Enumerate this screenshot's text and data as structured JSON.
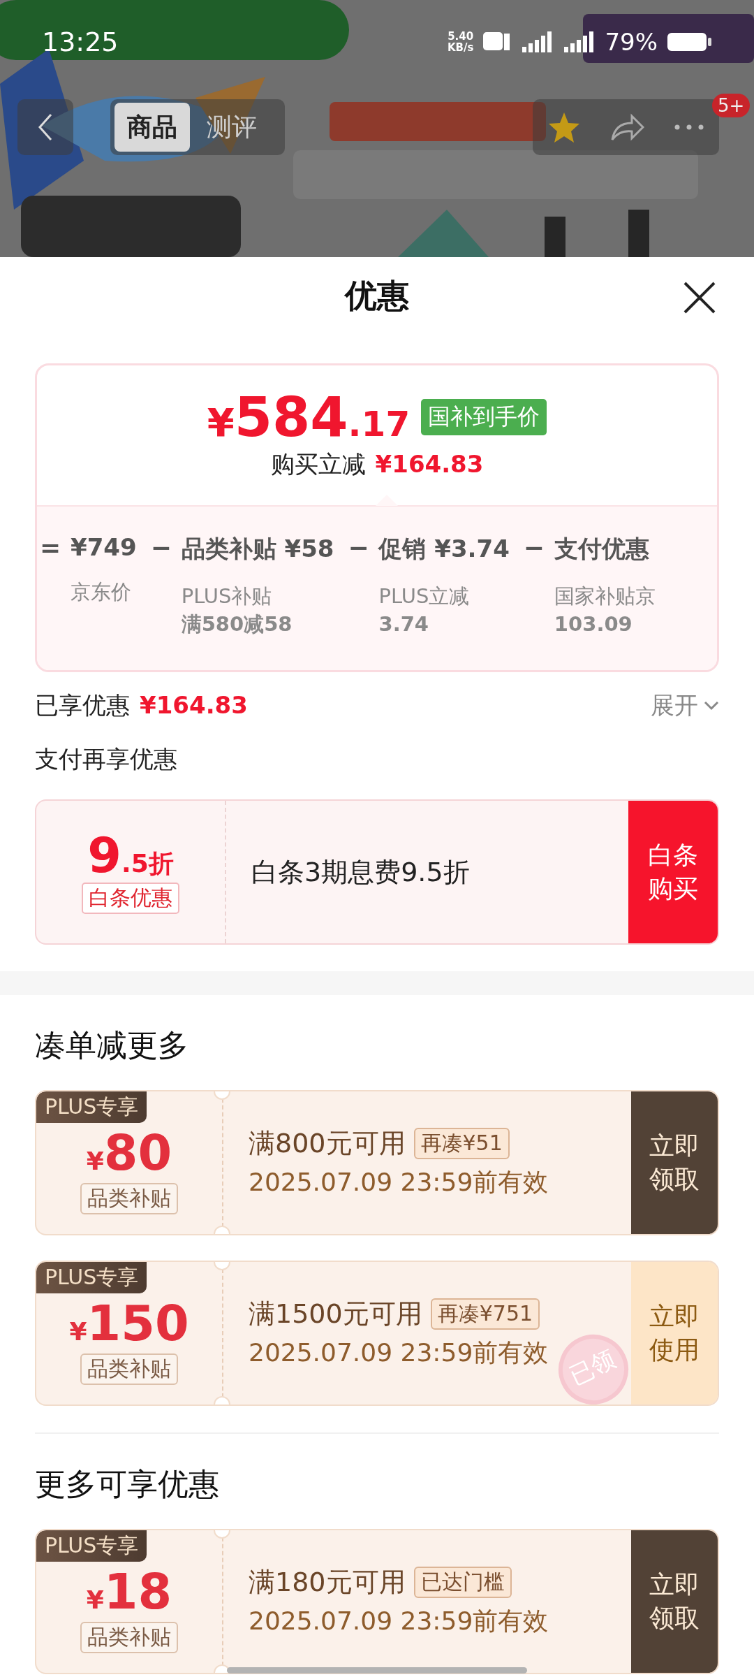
{
  "status_bar": {
    "time": "13:25",
    "net_speed": "5.40",
    "net_unit": "KB/s",
    "battery": "79%"
  },
  "nav": {
    "tabs": [
      {
        "label": "商品",
        "selected": true
      },
      {
        "label": "测评",
        "selected": false
      }
    ],
    "badge": "5+"
  },
  "sheet": {
    "title": "优惠"
  },
  "price_summary": {
    "final_price": "¥584.17",
    "price_tag": "国补到手价",
    "saving_label": "购买立减",
    "saving": "¥164.83",
    "breakdown": [
      {
        "operator": "=",
        "amount": "¥749",
        "label": "京东价"
      },
      {
        "operator": "−",
        "amount": "品类补贴 ¥58",
        "label": "PLUS补贴",
        "detail": "满580减58"
      },
      {
        "operator": "−",
        "amount": "促销 ¥3.74",
        "label": "PLUS立减",
        "detail": "3.74"
      },
      {
        "operator": "−",
        "amount": "支付优惠",
        "label": "国家补贴京",
        "detail": "103.09"
      }
    ]
  },
  "enjoyed": {
    "label": "已享优惠",
    "amount": "¥164.83",
    "toggle": "展开"
  },
  "pay_section": {
    "title": "支付再享优惠",
    "offer": {
      "discount": "9.5折",
      "tag": "白条优惠",
      "description": "白条3期息费9.5折",
      "button": "白条购买"
    }
  },
  "sections": [
    {
      "title": "凑单减更多",
      "coupons": [
        {
          "badge": "PLUS专享",
          "amount": "¥80",
          "category": "品类补贴",
          "condition": "满800元可用",
          "hint": "再凑¥51",
          "validity": "2025.07.09 23:59前有效",
          "button": "立即领取",
          "claimed": false
        },
        {
          "badge": "PLUS专享",
          "amount": "¥150",
          "category": "品类补贴",
          "condition": "满1500元可用",
          "hint": "再凑¥751",
          "validity": "2025.07.09 23:59前有效",
          "button": "立即使用",
          "claimed": true,
          "stamp": "已领"
        }
      ]
    },
    {
      "title": "更多可享优惠",
      "coupons": [
        {
          "badge": "PLUS专享",
          "amount": "¥18",
          "category": "品类补贴",
          "condition": "满180元可用",
          "hint": "已达门槛",
          "validity": "2025.07.09 23:59前有效",
          "button": "立即领取",
          "claimed": false
        }
      ]
    }
  ]
}
